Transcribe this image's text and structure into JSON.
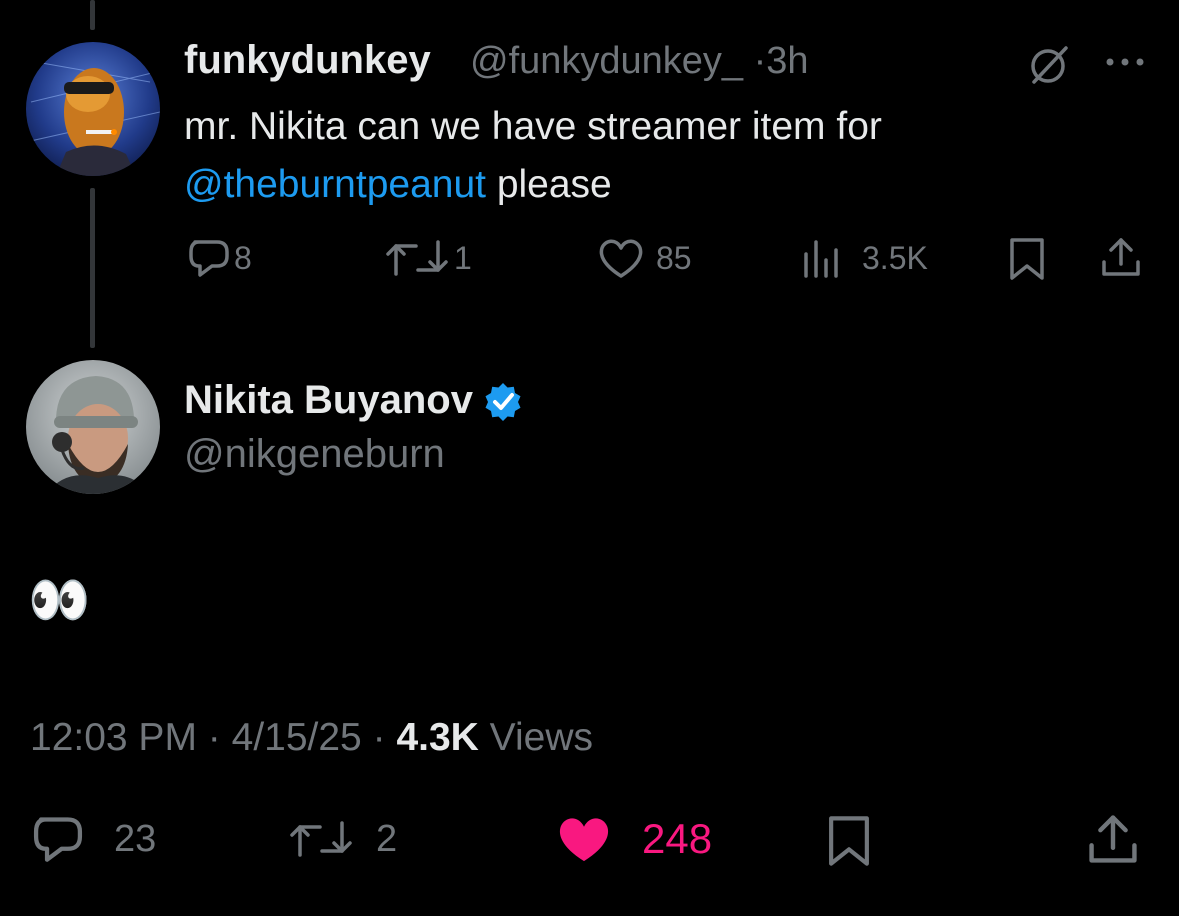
{
  "reply_tweet": {
    "display_name": "funkydunkey",
    "handle": "@funkydunkey_",
    "separator": "·",
    "time": "3h",
    "text_before": "mr. Nikita can we have streamer item for",
    "mention": "@theburntpeanut",
    "text_after": " please",
    "replies": "8",
    "reposts": "1",
    "likes": "85",
    "views": "3.5K"
  },
  "main_tweet": {
    "display_name": "Nikita Buyanov",
    "handle": "@nikgeneburn",
    "text": "👀",
    "time": "12:03 PM",
    "date": "4/15/25",
    "dot": "·",
    "views_count": "4.3K",
    "views_label": "Views",
    "replies": "23",
    "reposts": "2",
    "likes": "248"
  },
  "colors": {
    "background": "#000000",
    "text_primary": "#e7e9ea",
    "text_secondary": "#71767b",
    "link": "#1d9bf0",
    "verified": "#1d9bf0",
    "like_active": "#f91880",
    "thread_line": "#333639"
  },
  "icons": [
    "grok-icon",
    "more-icon",
    "reply-icon",
    "repost-icon",
    "like-icon",
    "views-icon",
    "bookmark-icon",
    "share-icon",
    "verified-badge-icon"
  ]
}
